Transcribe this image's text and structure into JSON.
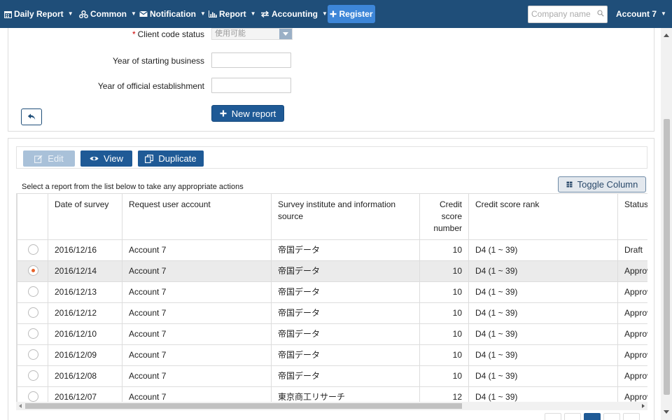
{
  "navbar": {
    "menus": [
      {
        "label": "Daily Report",
        "icon": "calendar-icon"
      },
      {
        "label": "Common",
        "icon": "sitemap-icon"
      },
      {
        "label": "Notification",
        "icon": "envelope-icon"
      },
      {
        "label": "Report",
        "icon": "bar-chart-icon"
      },
      {
        "label": "Accounting",
        "icon": "exchange-icon"
      }
    ],
    "register_label": "Register",
    "search_placeholder": "Company name",
    "account_label": "Account 7"
  },
  "form": {
    "client_code_status_label": "Client code status",
    "client_code_status_value": "使用可能",
    "year_starting_business_label": "Year of starting business",
    "year_starting_business_value": "",
    "year_official_establishment_label": "Year of official establishment",
    "year_official_establishment_value": "",
    "new_report_label": "New report"
  },
  "toolbar": {
    "edit_label": "Edit",
    "view_label": "View",
    "duplicate_label": "Duplicate",
    "toggle_column_label": "Toggle Column"
  },
  "list": {
    "hint": "Select a report from the list below to take any appropriate actions",
    "columns": [
      "",
      "Date of survey",
      "Request user account",
      "Survey institute and information source",
      "Credit score number",
      "Credit score rank",
      "Status"
    ],
    "rows": [
      {
        "selected": false,
        "date": "2016/12/16",
        "account": "Account 7",
        "source": "帝国データ",
        "score": "10",
        "rank": "D4 (1 ~ 39)",
        "status": "Draft"
      },
      {
        "selected": true,
        "date": "2016/12/14",
        "account": "Account 7",
        "source": "帝国データ",
        "score": "10",
        "rank": "D4 (1 ~ 39)",
        "status": "Approved"
      },
      {
        "selected": false,
        "date": "2016/12/13",
        "account": "Account 7",
        "source": "帝国データ",
        "score": "10",
        "rank": "D4 (1 ~ 39)",
        "status": "Approved"
      },
      {
        "selected": false,
        "date": "2016/12/12",
        "account": "Account 7",
        "source": "帝国データ",
        "score": "10",
        "rank": "D4 (1 ~ 39)",
        "status": "Approved"
      },
      {
        "selected": false,
        "date": "2016/12/10",
        "account": "Account 7",
        "source": "帝国データ",
        "score": "10",
        "rank": "D4 (1 ~ 39)",
        "status": "Approved"
      },
      {
        "selected": false,
        "date": "2016/12/09",
        "account": "Account 7",
        "source": "帝国データ",
        "score": "10",
        "rank": "D4 (1 ~ 39)",
        "status": "Approved"
      },
      {
        "selected": false,
        "date": "2016/12/08",
        "account": "Account 7",
        "source": "帝国データ",
        "score": "10",
        "rank": "D4 (1 ~ 39)",
        "status": "Approved"
      },
      {
        "selected": false,
        "date": "2016/12/07",
        "account": "Account 7",
        "source": "東京商工リサーチ",
        "score": "12",
        "rank": "D4 (1 ~ 39)",
        "status": "Approved"
      }
    ]
  },
  "colors": {
    "navbar_bg": "#1f4e79",
    "primary_button": "#1f5a96",
    "register_button": "#3d86d8",
    "radio_checked": "#e8622a",
    "required_marker": "#cc0000"
  }
}
